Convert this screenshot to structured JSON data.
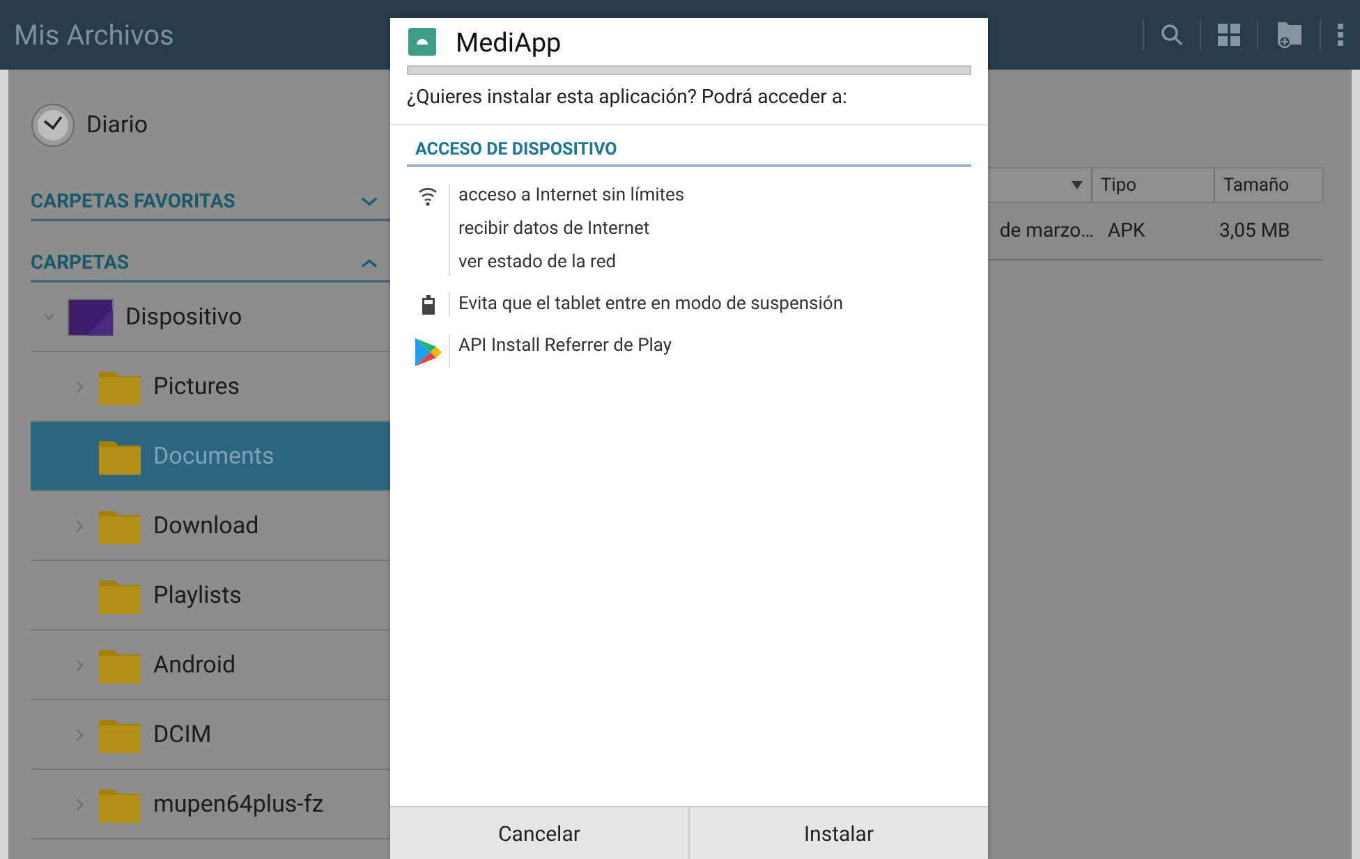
{
  "app_bar": {
    "title": "Mis Archivos"
  },
  "sidebar": {
    "recent": {
      "label": "Diario"
    },
    "sections": [
      {
        "title": "CARPETAS FAVORITAS",
        "expanded": false
      },
      {
        "title": "CARPETAS",
        "expanded": true,
        "items": [
          {
            "label": "Dispositivo",
            "kind": "device",
            "expandable": true,
            "expanded": true,
            "selected": false,
            "children": [
              {
                "label": "Pictures",
                "kind": "folder",
                "expandable": true,
                "expanded": false,
                "selected": false
              },
              {
                "label": "Documents",
                "kind": "folder",
                "expandable": false,
                "expanded": false,
                "selected": true
              },
              {
                "label": "Download",
                "kind": "folder",
                "expandable": true,
                "expanded": false,
                "selected": false
              },
              {
                "label": "Playlists",
                "kind": "folder",
                "expandable": false,
                "expanded": false,
                "selected": false
              },
              {
                "label": "Android",
                "kind": "folder",
                "expandable": true,
                "expanded": false,
                "selected": false
              },
              {
                "label": "DCIM",
                "kind": "folder",
                "expandable": true,
                "expanded": false,
                "selected": false
              },
              {
                "label": "mupen64plus-fz",
                "kind": "folder",
                "expandable": true,
                "expanded": false,
                "selected": false
              }
            ]
          }
        ]
      }
    ]
  },
  "table": {
    "columns": [
      {
        "sorted": true
      },
      {
        "label": "Tipo",
        "sorted": false
      },
      {
        "label": "Tamaño",
        "sorted": false
      }
    ],
    "rows": [
      [
        "de marzo…",
        "APK",
        "3,05 MB"
      ]
    ]
  },
  "dialog": {
    "title": "MediApp",
    "message": "¿Quieres instalar esta aplicación? Podrá acceder a:",
    "section": "ACCESO DE DISPOSITIVO",
    "permissions": [
      {
        "kind": "network",
        "lines": [
          "acceso a Internet sin límites",
          "recibir datos de Internet",
          "ver estado de la red"
        ]
      },
      {
        "kind": "battery",
        "lines": [
          "Evita que el tablet entre en modo de suspensión"
        ]
      },
      {
        "kind": "play",
        "lines": [
          "API Install Referrer de Play"
        ]
      }
    ],
    "buttons": [
      "Cancelar",
      "Instalar"
    ]
  }
}
